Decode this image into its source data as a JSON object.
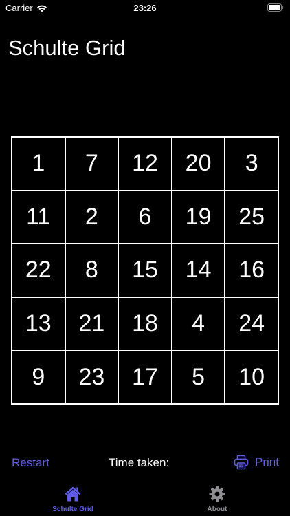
{
  "status_bar": {
    "carrier": "Carrier",
    "time": "23:26"
  },
  "page": {
    "title": "Schulte Grid"
  },
  "grid": {
    "numbers": [
      [
        1,
        7,
        12,
        20,
        3
      ],
      [
        11,
        2,
        6,
        19,
        25
      ],
      [
        22,
        8,
        15,
        14,
        16
      ],
      [
        13,
        21,
        18,
        4,
        24
      ],
      [
        9,
        23,
        17,
        5,
        10
      ]
    ]
  },
  "controls": {
    "restart_label": "Restart",
    "time_label": "Time taken:",
    "print_label": "Print"
  },
  "tabs": [
    {
      "label": "Schulte Grid",
      "icon": "house-icon",
      "active": true
    },
    {
      "label": "About",
      "icon": "gear-icon",
      "active": false
    }
  ],
  "colors": {
    "accent": "#5e5ce6",
    "inactive": "#8e8e93",
    "background": "#000000",
    "foreground": "#ffffff"
  }
}
